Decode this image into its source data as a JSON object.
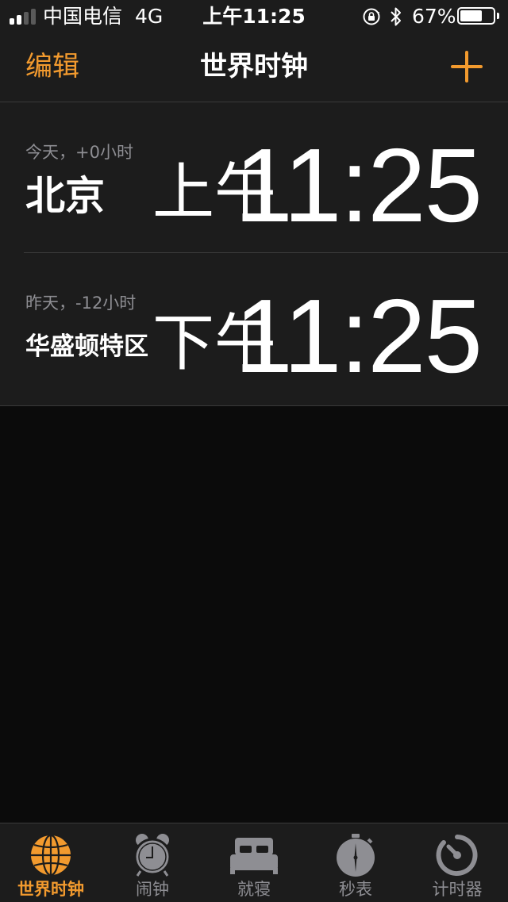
{
  "colors": {
    "accent": "#f29a2e",
    "background": "#0b0b0b",
    "bar": "#1c1c1c",
    "secondary_text": "#8e8e93",
    "inactive_icon": "#8e8e93"
  },
  "status_bar": {
    "carrier": "中国电信",
    "network": "4G",
    "time": "上午11:25",
    "battery_percent": "67%",
    "battery_level": 0.67,
    "signal_bars": 4,
    "signal_strength": 2,
    "icons": [
      "orientation-lock-icon",
      "bluetooth-icon",
      "battery-icon"
    ]
  },
  "nav_bar": {
    "edit_label": "编辑",
    "title": "世界时钟",
    "add_icon": "plus-icon"
  },
  "clocks": [
    {
      "offset_label": "今天，+0小时",
      "city": "北京",
      "period": "上午",
      "time": "11:25"
    },
    {
      "offset_label": "昨天，-12小时",
      "city": "华盛顿特区",
      "period": "下午",
      "time": "11:25"
    }
  ],
  "tab_bar": {
    "tabs": [
      {
        "label": "世界时钟",
        "icon": "globe-icon",
        "active": true
      },
      {
        "label": "闹钟",
        "icon": "alarm-clock-icon",
        "active": false
      },
      {
        "label": "就寝",
        "icon": "bed-icon",
        "active": false
      },
      {
        "label": "秒表",
        "icon": "stopwatch-icon",
        "active": false
      },
      {
        "label": "计时器",
        "icon": "timer-icon",
        "active": false
      }
    ]
  }
}
